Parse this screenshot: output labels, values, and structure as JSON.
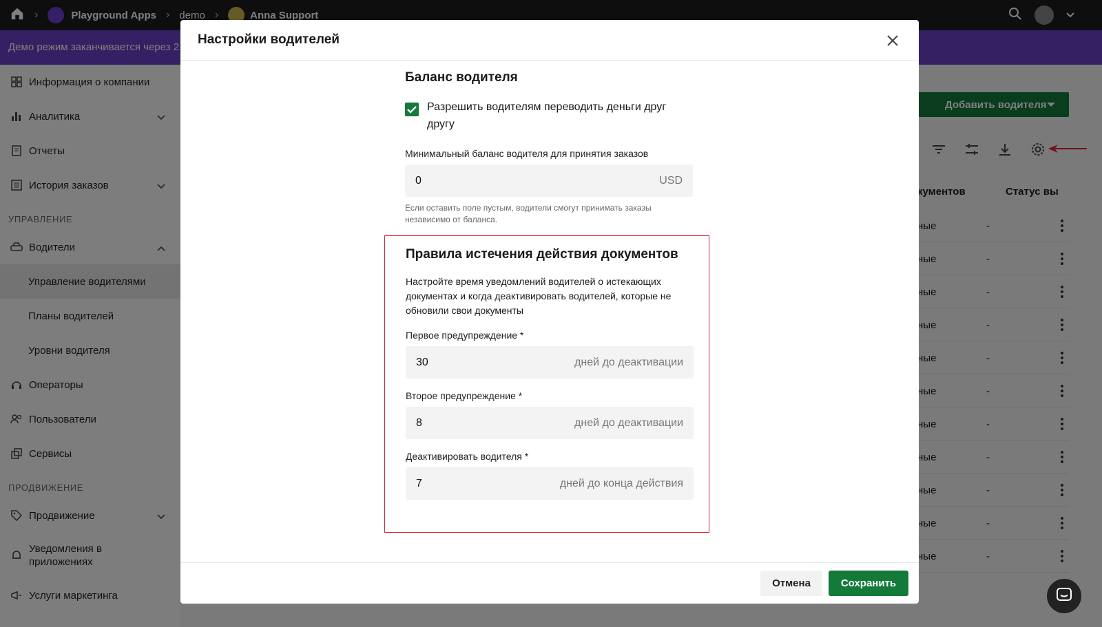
{
  "topbar": {
    "crumbs": [
      "Playground Apps",
      "demo",
      "Anna Support"
    ]
  },
  "banner": {
    "text": "Демо режим заканчивается через 2"
  },
  "sidebar": {
    "items": [
      {
        "label": "Информация о компании"
      },
      {
        "label": "Аналитика"
      },
      {
        "label": "Отчеты"
      },
      {
        "label": "История заказов"
      }
    ],
    "section_manage": "УПРАВЛЕНИЕ",
    "drivers": "Водители",
    "sub": [
      "Управление водителями",
      "Планы водителей",
      "Уровни водителя"
    ],
    "items2": [
      {
        "label": "Операторы"
      },
      {
        "label": "Пользователи"
      },
      {
        "label": "Сервисы"
      }
    ],
    "section_promo": "ПРОДВИЖЕНИЕ",
    "promo": "Продвижение",
    "notifications": "Уведомления в приложениях",
    "marketing": "Услуги маркетинга"
  },
  "background": {
    "add_button": "Добавить водителя",
    "col_docs": "кументов",
    "col_status": "Статус вы",
    "row_c1": "ные",
    "row_c2": "-"
  },
  "modal": {
    "title": "Настройки водителей",
    "balance_heading": "Баланс водителя",
    "allow_transfer": "Разрешить водителям переводить деньги друг другу",
    "min_balance_label": "Минимальный баланс водителя для принятия заказов",
    "min_balance_value": "0",
    "min_balance_suffix": "USD",
    "min_balance_hint": "Если оставить поле пустым, водители смогут принимать заказы независимо от баланса.",
    "rules_heading": "Правила истечения действия документов",
    "rules_desc": "Настройте время уведомлений водителей о истекающих документах и когда деактивировать водителей, которые не обновили свои документы",
    "first_label": "Первое предупреждение *",
    "first_value": "30",
    "first_suffix": "дней до деактивации",
    "second_label": "Второе предупреждение *",
    "second_value": "8",
    "second_suffix": "дней до деактивации",
    "deactivate_label": "Деактивировать водителя *",
    "deactivate_value": "7",
    "deactivate_suffix": "дней до конца действия",
    "cancel": "Отмена",
    "save": "Сохранить"
  },
  "colors": {
    "accent_green": "#137a3a",
    "banner_purple": "#6a40c7",
    "highlight_red": "#d21f2d"
  }
}
